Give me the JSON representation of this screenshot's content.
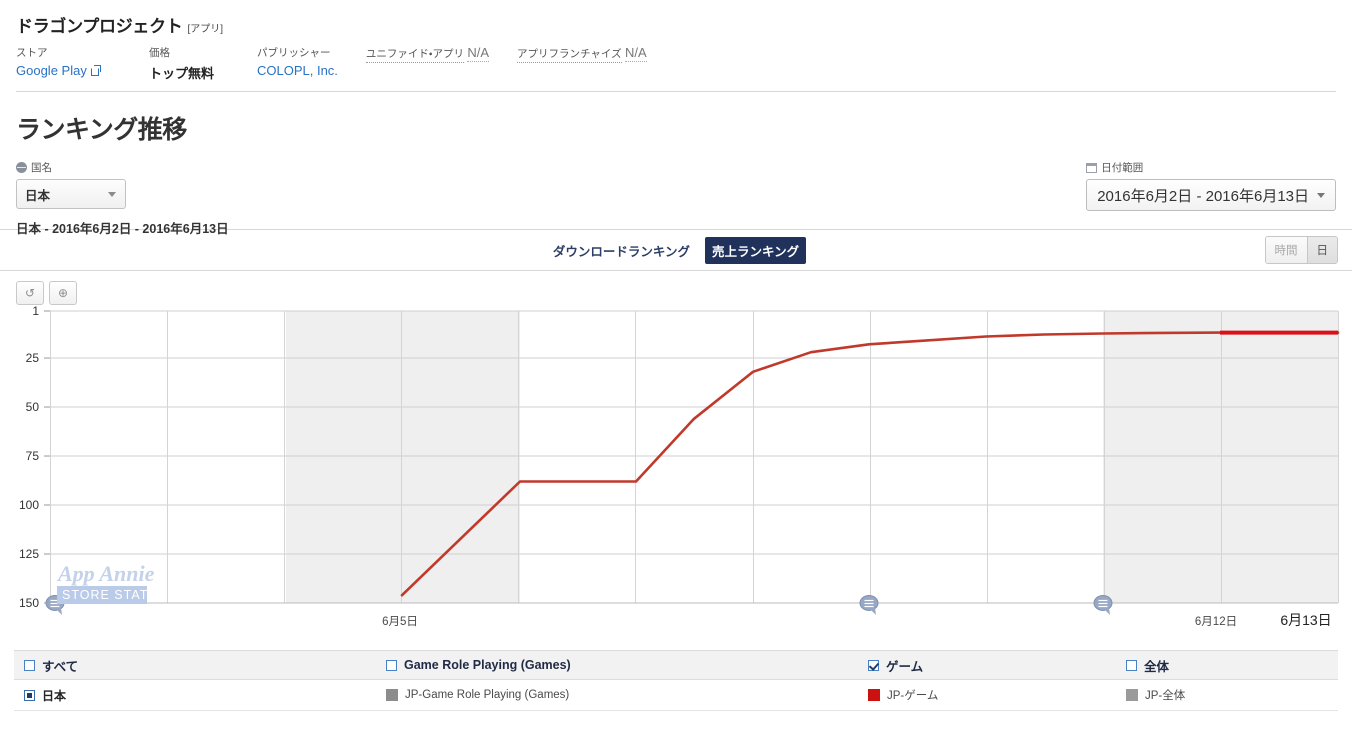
{
  "app_header": {
    "title": "ドラゴンプロジェクト",
    "kind": "[アプリ]",
    "meta": [
      {
        "label": "ストア",
        "value": "Google Play",
        "style": "link",
        "external_icon": true
      },
      {
        "label": "価格",
        "value": "トップ無料",
        "style": "bold"
      },
      {
        "label": "パブリッシャー",
        "value": "COLOPL, Inc.",
        "style": "link"
      },
      {
        "label": "ユニファイド・アプリ",
        "value": "N/A",
        "style": "na",
        "dotted_label": true
      },
      {
        "label": "アプリフランチャイズ",
        "value": "N/A",
        "style": "na",
        "dotted_label": true
      }
    ]
  },
  "page": {
    "title": "ランキング推移"
  },
  "filters": {
    "country": {
      "label": "国名",
      "icon": "globe-icon",
      "value": "日本"
    },
    "date_range": {
      "label": "日付範囲",
      "icon": "calendar-icon",
      "value": "2016年6月2日 - 2016年6月13日"
    },
    "summary": "日本 - 2016年6月2日 - 2016年6月13日"
  },
  "tabs": {
    "items": [
      {
        "label": "ダウンロードランキング",
        "active": false
      },
      {
        "label": "売上ランキング",
        "active": true
      }
    ],
    "granularity": [
      {
        "label": "時間",
        "active": false
      },
      {
        "label": "日",
        "active": true
      }
    ]
  },
  "chart_tools": [
    {
      "name": "reset-zoom-button",
      "glyph": "↺"
    },
    {
      "name": "zoom-in-button",
      "glyph": "⊕"
    }
  ],
  "watermark": {
    "brand": "App Annie",
    "sub": "STORE STATS"
  },
  "chart_data": {
    "type": "line",
    "title": "ランキング推移",
    "xlabel": "",
    "ylabel": "",
    "ylim": [
      1,
      150
    ],
    "y_inverted": true,
    "yticks": [
      1,
      25,
      50,
      75,
      100,
      125,
      150
    ],
    "ytick_labels": [
      "1",
      "25",
      "50",
      "75",
      "100",
      "125",
      "150"
    ],
    "xticks": [
      "6月5日",
      "6月12日",
      "6月13日"
    ],
    "xtick_positions": [
      400,
      1216,
      1306
    ],
    "xtick_emphasis": [
      false,
      false,
      true
    ],
    "grid": true,
    "shaded_bands": [
      {
        "from_x": 286,
        "to_x": 520,
        "color": "#efefef"
      },
      {
        "from_x": 1103,
        "to_x": 1338,
        "color": "#efefef"
      }
    ],
    "legend_position": "below",
    "series": [
      {
        "name": "JP-ゲーム",
        "color": "#c0392b",
        "highlight_color": "#d91118",
        "x": [
          402,
          461,
          520,
          578,
          636,
          694,
          753,
          811,
          869,
          927,
          986,
          1044,
          1103,
          1161,
          1220,
          1279,
          1338
        ],
        "values": [
          146,
          117,
          88,
          88,
          88,
          56,
          32,
          22,
          18,
          16,
          14,
          13,
          12.5,
          12.2,
          12,
          12,
          12
        ]
      }
    ],
    "markers": [
      {
        "name": "range-handle-left",
        "x": 55
      },
      {
        "name": "annotation-marker",
        "x": 869
      },
      {
        "name": "annotation-marker",
        "x": 1103
      }
    ]
  },
  "legend": {
    "header": [
      {
        "label": "すべて",
        "checked": false
      },
      {
        "label": "Game Role Playing (Games)",
        "checked": false
      },
      {
        "label": "ゲーム",
        "checked": true
      },
      {
        "label": "全体",
        "checked": false
      }
    ],
    "rows": [
      {
        "label": "日本",
        "type": "radio",
        "emphasis": true
      },
      {
        "label": "JP-Game Role Playing (Games)",
        "type": "swatch",
        "color": "#8c8c8c"
      },
      {
        "label": "JP-ゲーム",
        "type": "swatch",
        "color": "#cc1111"
      },
      {
        "label": "JP-全体",
        "type": "swatch",
        "color": "#9a9a9a"
      }
    ]
  }
}
